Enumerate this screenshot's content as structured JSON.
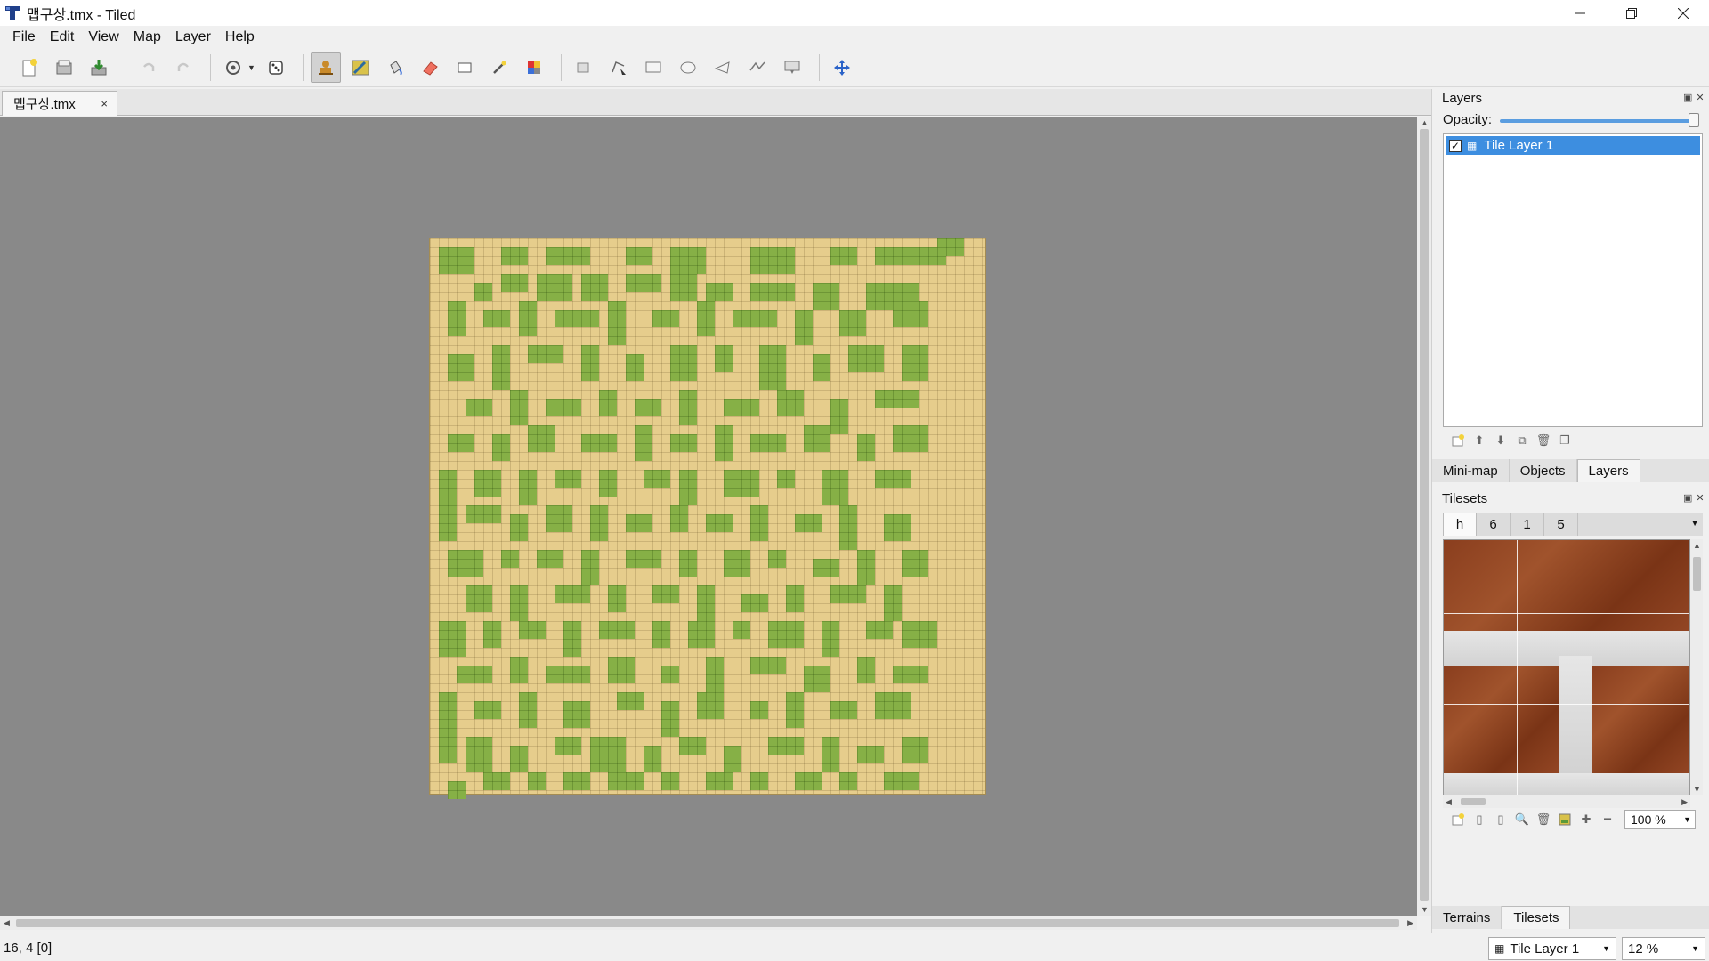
{
  "window": {
    "title": "맵구상.tmx - Tiled",
    "app_icon": "tiled-logo-icon",
    "controls": [
      "minimize-icon",
      "restore-icon",
      "close-icon"
    ]
  },
  "menu": {
    "items": [
      "File",
      "Edit",
      "View",
      "Map",
      "Layer",
      "Help"
    ]
  },
  "toolbar": {
    "groups": [
      [
        "new-file-icon",
        "open-file-icon",
        "save-file-icon"
      ],
      [
        "undo-icon",
        "redo-icon"
      ],
      [
        "random-mode-icon",
        "wang-dice-icon"
      ],
      [
        "stamp-brush-icon",
        "terrain-brush-icon",
        "bucket-fill-icon",
        "eraser-icon",
        "rectangular-select-icon",
        "magic-wand-icon",
        "select-same-tile-icon"
      ],
      [
        "select-objects-icon",
        "edit-polygons-icon",
        "insert-rectangle-icon",
        "insert-ellipse-icon",
        "insert-polygon-icon",
        "insert-polyline-icon",
        "insert-tile-icon"
      ],
      [
        "move-icon"
      ]
    ],
    "active_tool": "stamp-brush-icon"
  },
  "document": {
    "tab_label": "맵구상.tmx",
    "tab_close": "×"
  },
  "layers_panel": {
    "title": "Layers",
    "opacity_label": "Opacity:",
    "opacity_value": 1.0,
    "layers": [
      {
        "name": "Tile Layer 1",
        "visible": true,
        "selected": true
      }
    ],
    "tool_icons": [
      "add-layer-icon",
      "raise-layer-icon",
      "lower-layer-icon",
      "duplicate-layer-icon",
      "delete-layer-icon",
      "toggle-other-layers-icon"
    ]
  },
  "upper_tabs": {
    "items": [
      "Mini-map",
      "Objects",
      "Layers"
    ],
    "active": "Layers"
  },
  "tilesets_panel": {
    "title": "Tilesets",
    "tabs": [
      "h",
      "6",
      "1",
      "5"
    ],
    "active_tab": "h",
    "zoom": "100 %",
    "tool_icons": [
      "new-tileset-icon",
      "import-tileset-icon",
      "export-tileset-icon",
      "tileset-properties-icon",
      "delete-tileset-icon",
      "edit-terrain-icon",
      "add-tiles-icon",
      "remove-tiles-icon"
    ]
  },
  "lower_tabs": {
    "items": [
      "Terrains",
      "Tilesets"
    ],
    "active": "Tilesets"
  },
  "status": {
    "position": "16, 4 [0]",
    "layer": "Tile Layer 1",
    "zoom": "12 %"
  },
  "colors": {
    "sand": "#e6cd8c",
    "grass": "#86b046",
    "canvas_bg": "#898989",
    "selection": "#3d8ee0"
  }
}
